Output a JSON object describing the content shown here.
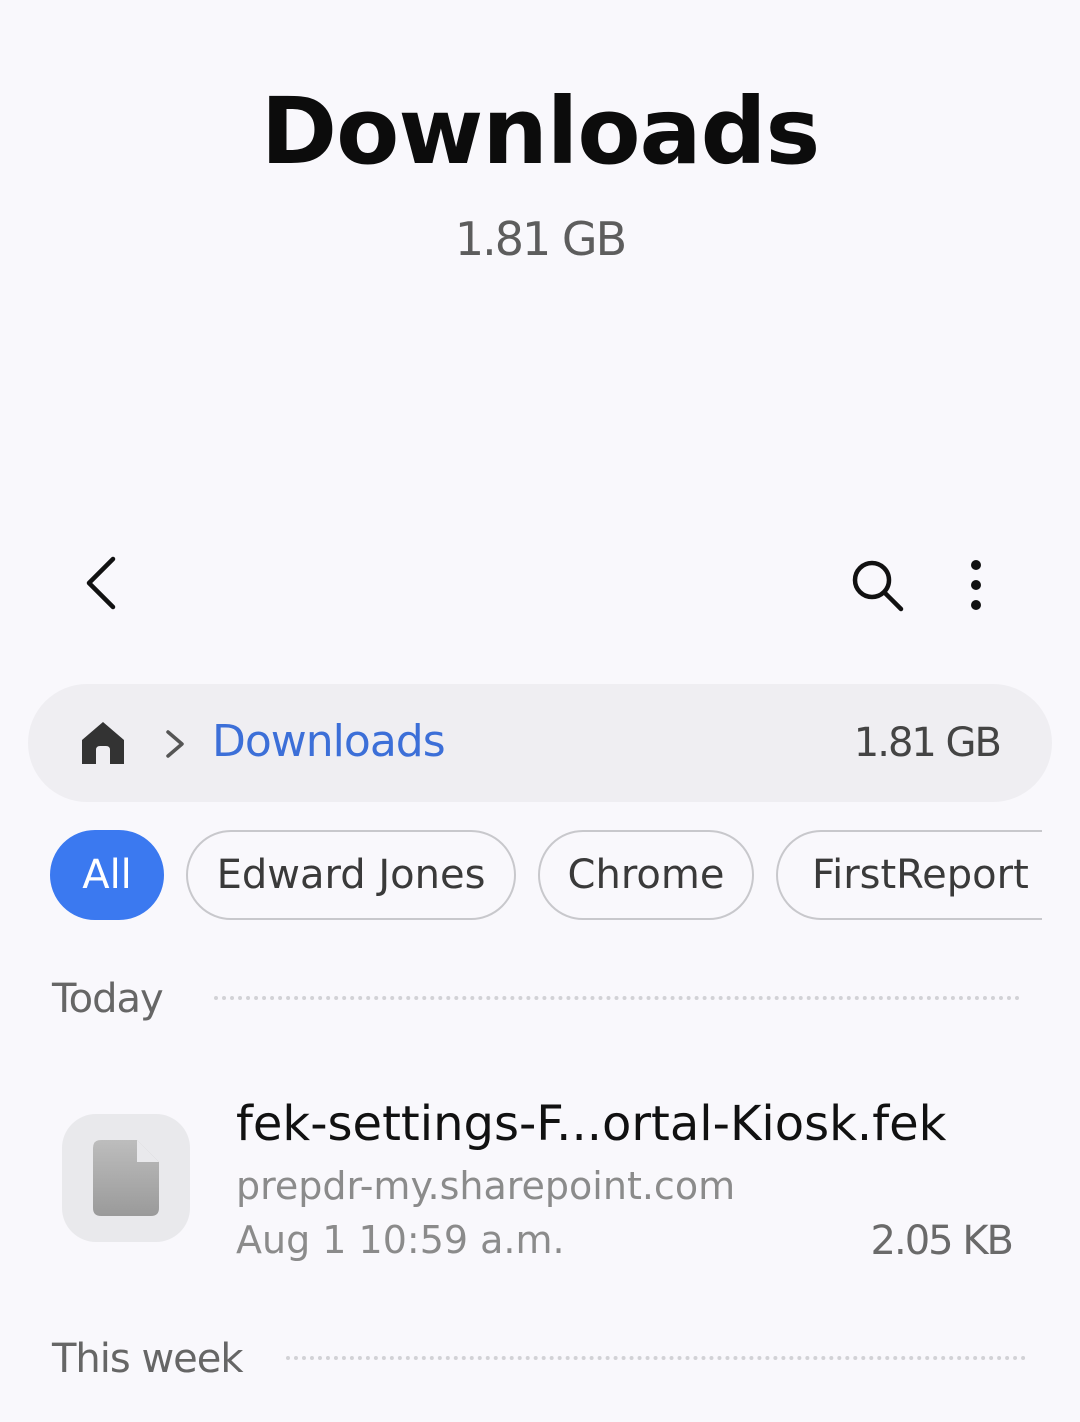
{
  "header": {
    "title": "Downloads",
    "subtitle": "1.81 GB"
  },
  "toolbar": {
    "back_icon": "back-arrow-icon",
    "search_icon": "search-icon",
    "more_icon": "more-vert-icon"
  },
  "breadcrumb": {
    "home_icon": "home-icon",
    "current": "Downloads",
    "size": "1.81 GB"
  },
  "filters": [
    {
      "label": "All",
      "active": true
    },
    {
      "label": "Edward Jones",
      "active": false
    },
    {
      "label": "Chrome",
      "active": false
    },
    {
      "label": "FirstReport",
      "active": false
    }
  ],
  "sections": [
    {
      "label": "Today",
      "files": [
        {
          "name": "fek-settings-F...ortal-Kiosk.fek",
          "source": "prepdr-my.sharepoint.com",
          "date": "Aug 1 10:59 a.m.",
          "size": "2.05 KB",
          "icon": "file-icon"
        }
      ]
    },
    {
      "label": "This week",
      "files": []
    }
  ],
  "colors": {
    "accent": "#3b79f0",
    "link": "#3c6fd8",
    "background": "#f9f8fc"
  }
}
